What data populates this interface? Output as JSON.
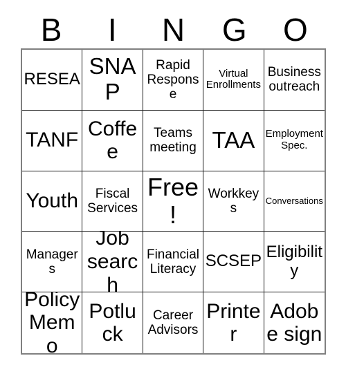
{
  "card": {
    "title_letters": [
      "B",
      "I",
      "N",
      "G",
      "O"
    ],
    "free_space": "Free!",
    "rows": [
      [
        {
          "label": "RESEA",
          "size": "lg"
        },
        {
          "label": "SNAP",
          "size": "xxl"
        },
        {
          "label": "Rapid Response",
          "size": "md"
        },
        {
          "label": "Virtual Enrollments",
          "size": "sm"
        },
        {
          "label": "Business outreach",
          "size": "md"
        }
      ],
      [
        {
          "label": "TANF",
          "size": "xl"
        },
        {
          "label": "Coffee",
          "size": "xl"
        },
        {
          "label": "Teams meeting",
          "size": "md"
        },
        {
          "label": "TAA",
          "size": "xxl"
        },
        {
          "label": "Employment Spec.",
          "size": "sm"
        }
      ],
      [
        {
          "label": "Youth",
          "size": "xl"
        },
        {
          "label": "Fiscal Services",
          "size": "md"
        },
        {
          "label": "Free!",
          "size": "free"
        },
        {
          "label": "Workkeys",
          "size": "md"
        },
        {
          "label": "Conversations",
          "size": "xs"
        }
      ],
      [
        {
          "label": "Managers",
          "size": "md"
        },
        {
          "label": "Job search",
          "size": "xl"
        },
        {
          "label": "Financial Literacy",
          "size": "md"
        },
        {
          "label": "SCSEP",
          "size": "lg"
        },
        {
          "label": "Eligibility",
          "size": "lg"
        }
      ],
      [
        {
          "label": "Policy Memo",
          "size": "xl"
        },
        {
          "label": "Potluck",
          "size": "xl"
        },
        {
          "label": "Career Advisors",
          "size": "md"
        },
        {
          "label": "Printer",
          "size": "xl"
        },
        {
          "label": "Adobe sign",
          "size": "xl"
        }
      ]
    ]
  },
  "colors": {
    "background": "#ffffff",
    "text": "#000000",
    "cell_border": "#1a1a1a",
    "outer_border": "#808080"
  }
}
